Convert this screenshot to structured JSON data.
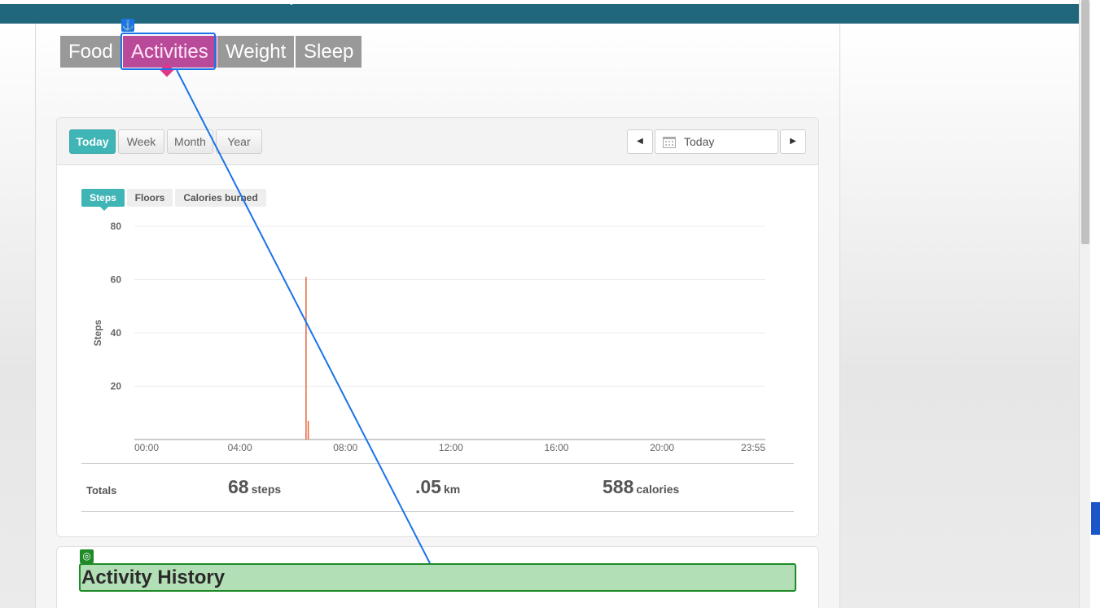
{
  "nav": {
    "tabs": [
      {
        "label": "Food"
      },
      {
        "label": "Activities"
      },
      {
        "label": "Weight"
      },
      {
        "label": "Sleep"
      }
    ],
    "anchor_icon": "anchor-icon"
  },
  "range": {
    "buttons": [
      "Today",
      "Week",
      "Month",
      "Year"
    ],
    "selected": "Today",
    "date_value": "Today",
    "prev_icon": "caret-left-icon",
    "next_icon": "caret-right-icon",
    "calendar_icon": "calendar-icon"
  },
  "metrics": {
    "tabs": [
      "Steps",
      "Floors",
      "Calories burned"
    ],
    "selected": "Steps"
  },
  "chart_data": {
    "type": "bar",
    "ylabel": "Steps",
    "xlabel": "",
    "title": "",
    "x_ticks": [
      "00:00",
      "04:00",
      "08:00",
      "12:00",
      "16:00",
      "20:00",
      "23:55"
    ],
    "y_ticks": [
      20,
      40,
      60,
      80
    ],
    "ylim": [
      0,
      80
    ],
    "x_domain_minutes": [
      0,
      1435
    ],
    "grid": true,
    "bar_color": "#e8643c",
    "series": [
      {
        "points": [
          {
            "time": "06:30",
            "value": 61
          },
          {
            "time": "06:35",
            "value": 7
          }
        ]
      }
    ]
  },
  "totals": {
    "label": "Totals",
    "steps": {
      "value": "68",
      "unit": "steps"
    },
    "distance": {
      "value": ".05",
      "unit": "km"
    },
    "calories": {
      "value": "588",
      "unit": "calories"
    }
  },
  "history": {
    "title": "Activity History",
    "target_icon": "target-icon"
  },
  "colors": {
    "topbar": "#21677c",
    "active_nav": "#b94a9a",
    "teal": "#40b5b6",
    "highlight_green": "#b3dfb6"
  }
}
